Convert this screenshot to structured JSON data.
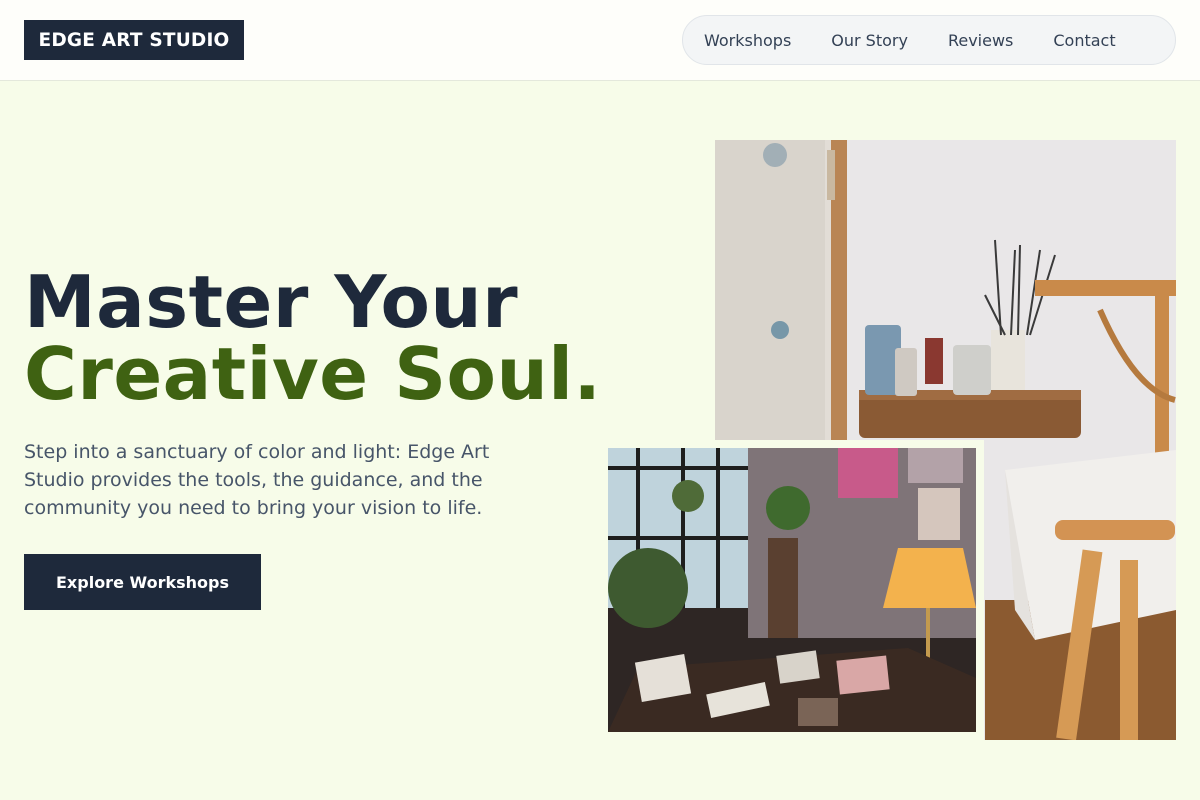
{
  "brand": {
    "logo_text": "EDGE ART STUDIO"
  },
  "nav": {
    "items": [
      {
        "label": "Workshops"
      },
      {
        "label": "Our Story"
      },
      {
        "label": "Reviews"
      },
      {
        "label": "Contact"
      }
    ]
  },
  "hero": {
    "title_line1": "Master Your",
    "title_line2": "Creative Soul.",
    "description": "Step into a sanctuary of color and light: Edge Art Studio provides the tools, the guidance, and the community you need to bring your vision to life.",
    "cta_label": "Explore Workshops"
  },
  "colors": {
    "background": "#f7fce9",
    "primary_dark": "#1e293b",
    "accent_green": "#3f6212",
    "body_text": "#475569"
  },
  "images": {
    "main": "studio-easel-photo",
    "inset": "studio-interior-photo"
  }
}
